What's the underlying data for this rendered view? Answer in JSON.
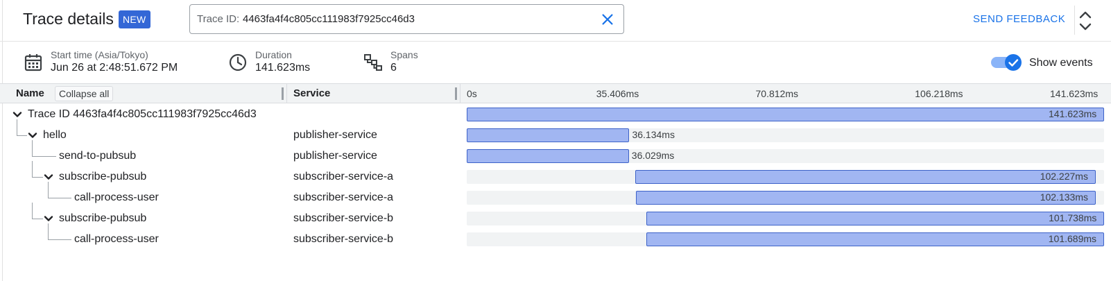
{
  "header": {
    "title": "Trace details",
    "badge": "NEW",
    "search": {
      "label": "Trace ID:",
      "value": "4463fa4f4c805cc111983f7925cc46d3"
    },
    "send_feedback": "SEND FEEDBACK"
  },
  "summary": {
    "start_time": {
      "label": "Start time (Asia/Tokyo)",
      "value": "Jun 26 at 2:48:51.672 PM",
      "icon": "calendar-icon"
    },
    "duration": {
      "label": "Duration",
      "value": "141.623ms",
      "icon": "clock-icon"
    },
    "spans": {
      "label": "Spans",
      "value": "6",
      "icon": "span-tree-icon"
    },
    "show_events": {
      "label": "Show events",
      "enabled": true
    }
  },
  "table": {
    "headers": {
      "name": "Name",
      "collapse_all": "Collapse all",
      "service": "Service"
    },
    "ticks": [
      "0s",
      "35.406ms",
      "70.812ms",
      "106.218ms",
      "141.623ms"
    ],
    "total_ms": 141.623,
    "rows": [
      {
        "name": "Trace ID 4463fa4f4c805cc111983f7925cc46d3",
        "service": "",
        "start_ms": 0,
        "duration_ms": 141.623,
        "label": "141.623ms",
        "depth": 0,
        "expandable": true
      },
      {
        "name": "hello",
        "service": "publisher-service",
        "start_ms": 0,
        "duration_ms": 36.134,
        "label": "36.134ms",
        "depth": 1,
        "expandable": true
      },
      {
        "name": "send-to-pubsub",
        "service": "publisher-service",
        "start_ms": 0,
        "duration_ms": 36.029,
        "label": "36.029ms",
        "depth": 2,
        "expandable": false
      },
      {
        "name": "subscribe-pubsub",
        "service": "subscriber-service-a",
        "start_ms": 37.5,
        "duration_ms": 102.227,
        "label": "102.227ms",
        "depth": 2,
        "expandable": true
      },
      {
        "name": "call-process-user",
        "service": "subscriber-service-a",
        "start_ms": 37.6,
        "duration_ms": 102.133,
        "label": "102.133ms",
        "depth": 3,
        "expandable": false
      },
      {
        "name": "subscribe-pubsub",
        "service": "subscriber-service-b",
        "start_ms": 39.9,
        "duration_ms": 101.738,
        "label": "101.738ms",
        "depth": 2,
        "expandable": true
      },
      {
        "name": "call-process-user",
        "service": "subscriber-service-b",
        "start_ms": 39.9,
        "duration_ms": 101.689,
        "label": "101.689ms",
        "depth": 3,
        "expandable": false
      }
    ]
  },
  "colors": {
    "accent": "#1a73e8",
    "badge": "#3367d6",
    "bar_fill": "#a1b6f2",
    "bar_border": "#3d62c8"
  }
}
